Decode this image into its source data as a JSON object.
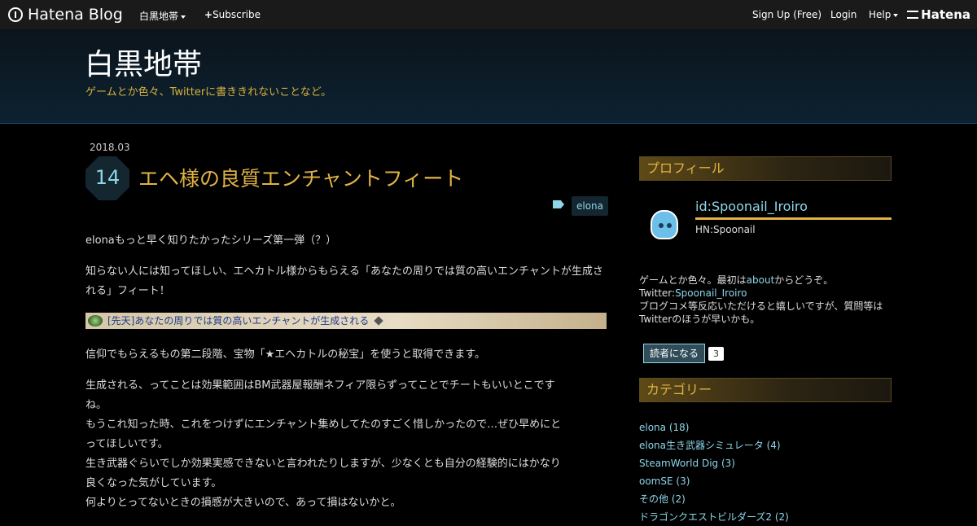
{
  "topbar": {
    "brand": "Hatena Blog",
    "blog_menu": "白黒地帯",
    "subscribe": "Subscribe",
    "signup": "Sign Up (Free)",
    "login": "Login",
    "help": "Help",
    "hatena": "Hatena"
  },
  "blog": {
    "title": "白黒地帯",
    "description": "ゲームとか色々、Twitterに書ききれないことなど。"
  },
  "entry": {
    "date_ym": "2018.03",
    "date_d": "14",
    "title": "エヘ様の良質エンチャントフィート",
    "tag": "elona",
    "para1": "elonaもっと早く知りたかったシリーズ第一弾（？）",
    "para2": "知らない人には知ってほしい、エヘカトル様からもらえる「あなたの周りでは質の高いエンチャントが生成される」フィート！",
    "banner": "[先天]あなたの周りでは質の高いエンチャントが生成される",
    "para3": "信仰でもらえるもの第二段階、宝物「★エヘカトルの秘宝」を使うと取得できます。",
    "para4_l1": "生成される、ってことは効果範囲はBM武器屋報酬ネフィア限らずってことでチートもいいとこです",
    "para4_l2": "ね。",
    "para4_l3": "もうこれ知った時、これをつけずにエンチャント集めしてたのすごく惜しかったので…ぜひ早めにと",
    "para4_l4": "ってほしいです。",
    "para4_l5": "生き武器ぐらいでしか効果実感できないと言われたりしますが、少なくとも自分の経験的にはかなり",
    "para4_l6": "良くなった気がしています。",
    "para4_l7": "何よりとってないときの損感が大きいので、あって損はないかと。"
  },
  "sidebar": {
    "profile_title": "プロフィール",
    "profile_id": "id:Spoonail_Iroiro",
    "profile_hn": "HN:Spoonail",
    "bio_l1a": "ゲームとか色々。最初は",
    "bio_l1_link": "about",
    "bio_l1b": "からどうぞ。",
    "bio_l2a": "Twitter:",
    "bio_l2_link": "Spoonail_Iroiro",
    "bio_l3": "ブログコメ等反応いただけると嬉しいですが、質問等は",
    "bio_l4": "Twitterのほうが早いかも。",
    "subscribe_label": "読者になる",
    "subscriber_count": "3",
    "category_title": "カテゴリー",
    "categories": [
      "elona (18)",
      "elona生き武器シミュレータ (4)",
      "SteamWorld Dig (3)",
      "oomSE (3)",
      "その他 (2)",
      "ドラゴンクエストビルダーズ2 (2)"
    ]
  }
}
